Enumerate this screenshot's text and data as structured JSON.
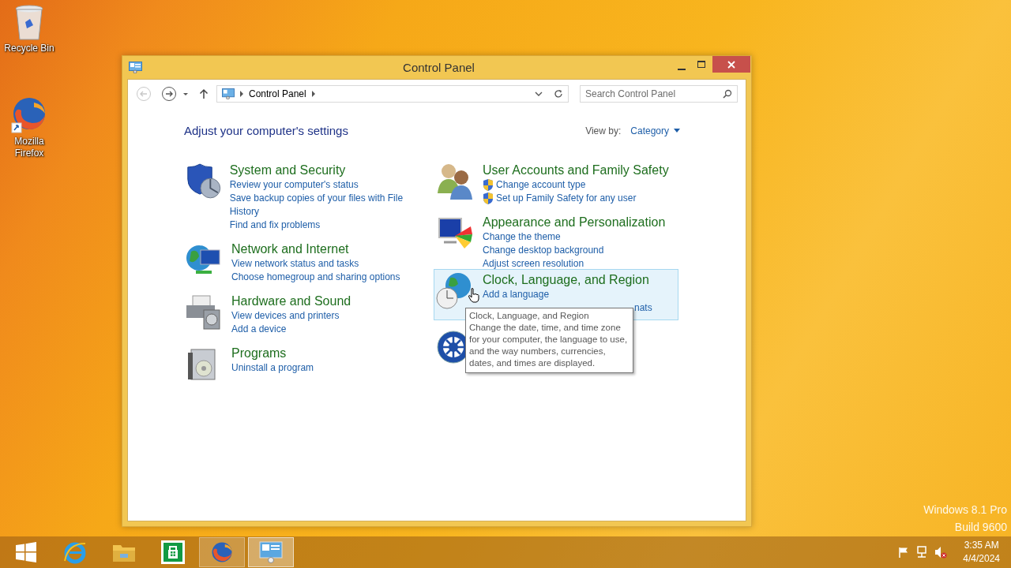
{
  "desktop": {
    "icons": [
      {
        "kind": "recycle",
        "label": "Recycle Bin"
      },
      {
        "kind": "firefox",
        "label": "Mozilla Firefox"
      }
    ]
  },
  "window": {
    "title": "Control Panel",
    "nav": {
      "breadcrumb": [
        "Control Panel"
      ],
      "search": {
        "placeholder": "Search Control Panel"
      }
    },
    "heading": "Adjust your computer's settings",
    "view_by": {
      "label": "View by:",
      "value": "Category"
    },
    "columns": [
      [
        {
          "kind": "security",
          "title": "System and Security",
          "hovered": false,
          "links": [
            {
              "text": "Review your computer's status",
              "shield": false
            },
            {
              "text": "Save backup copies of your files with File History",
              "shield": false
            },
            {
              "text": "Find and fix problems",
              "shield": false
            }
          ]
        },
        {
          "kind": "network",
          "title": "Network and Internet",
          "hovered": false,
          "links": [
            {
              "text": "View network status and tasks",
              "shield": false
            },
            {
              "text": "Choose homegroup and sharing options",
              "shield": false
            }
          ]
        },
        {
          "kind": "hardware",
          "title": "Hardware and Sound",
          "hovered": false,
          "links": [
            {
              "text": "View devices and printers",
              "shield": false
            },
            {
              "text": "Add a device",
              "shield": false
            }
          ]
        },
        {
          "kind": "programs",
          "title": "Programs",
          "hovered": false,
          "links": [
            {
              "text": "Uninstall a program",
              "shield": false
            }
          ]
        }
      ],
      [
        {
          "kind": "users",
          "title": "User Accounts and Family Safety",
          "hovered": false,
          "links": [
            {
              "text": "Change account type",
              "shield": true
            },
            {
              "text": "Set up Family Safety for any user",
              "shield": true
            }
          ]
        },
        {
          "kind": "appearance",
          "title": "Appearance and Personalization",
          "hovered": false,
          "links": [
            {
              "text": "Change the theme",
              "shield": false
            },
            {
              "text": "Change desktop background",
              "shield": false
            },
            {
              "text": "Adjust screen resolution",
              "shield": false
            }
          ]
        },
        {
          "kind": "clock",
          "title": "Clock, Language, and Region",
          "hovered": true,
          "links": [
            {
              "text": "Add a language",
              "shield": false
            },
            {
              "text": "nats",
              "shield": false,
              "covered": true
            }
          ]
        },
        {
          "kind": "ease",
          "hovered": false
        }
      ]
    ],
    "tooltip": {
      "title": "Clock, Language, and Region",
      "text": "Change the date, time, and time zone for your computer, the language to use, and the way numbers, currencies, dates, and times are displayed."
    }
  },
  "os_label": [
    "Windows 8.1 Pro",
    "Build 9600"
  ],
  "taskbar": {
    "apps": [
      {
        "kind": "start",
        "selected": false,
        "running": false
      },
      {
        "kind": "ie",
        "selected": false,
        "running": false
      },
      {
        "kind": "explorer",
        "selected": false,
        "running": false
      },
      {
        "kind": "store",
        "selected": false,
        "running": false
      },
      {
        "kind": "firefox",
        "selected": false,
        "running": true
      },
      {
        "kind": "controlpanel",
        "selected": true,
        "running": true
      }
    ],
    "tray": {
      "volume_muted": true,
      "time": "3:35 AM",
      "date": "4/4/2024"
    }
  }
}
